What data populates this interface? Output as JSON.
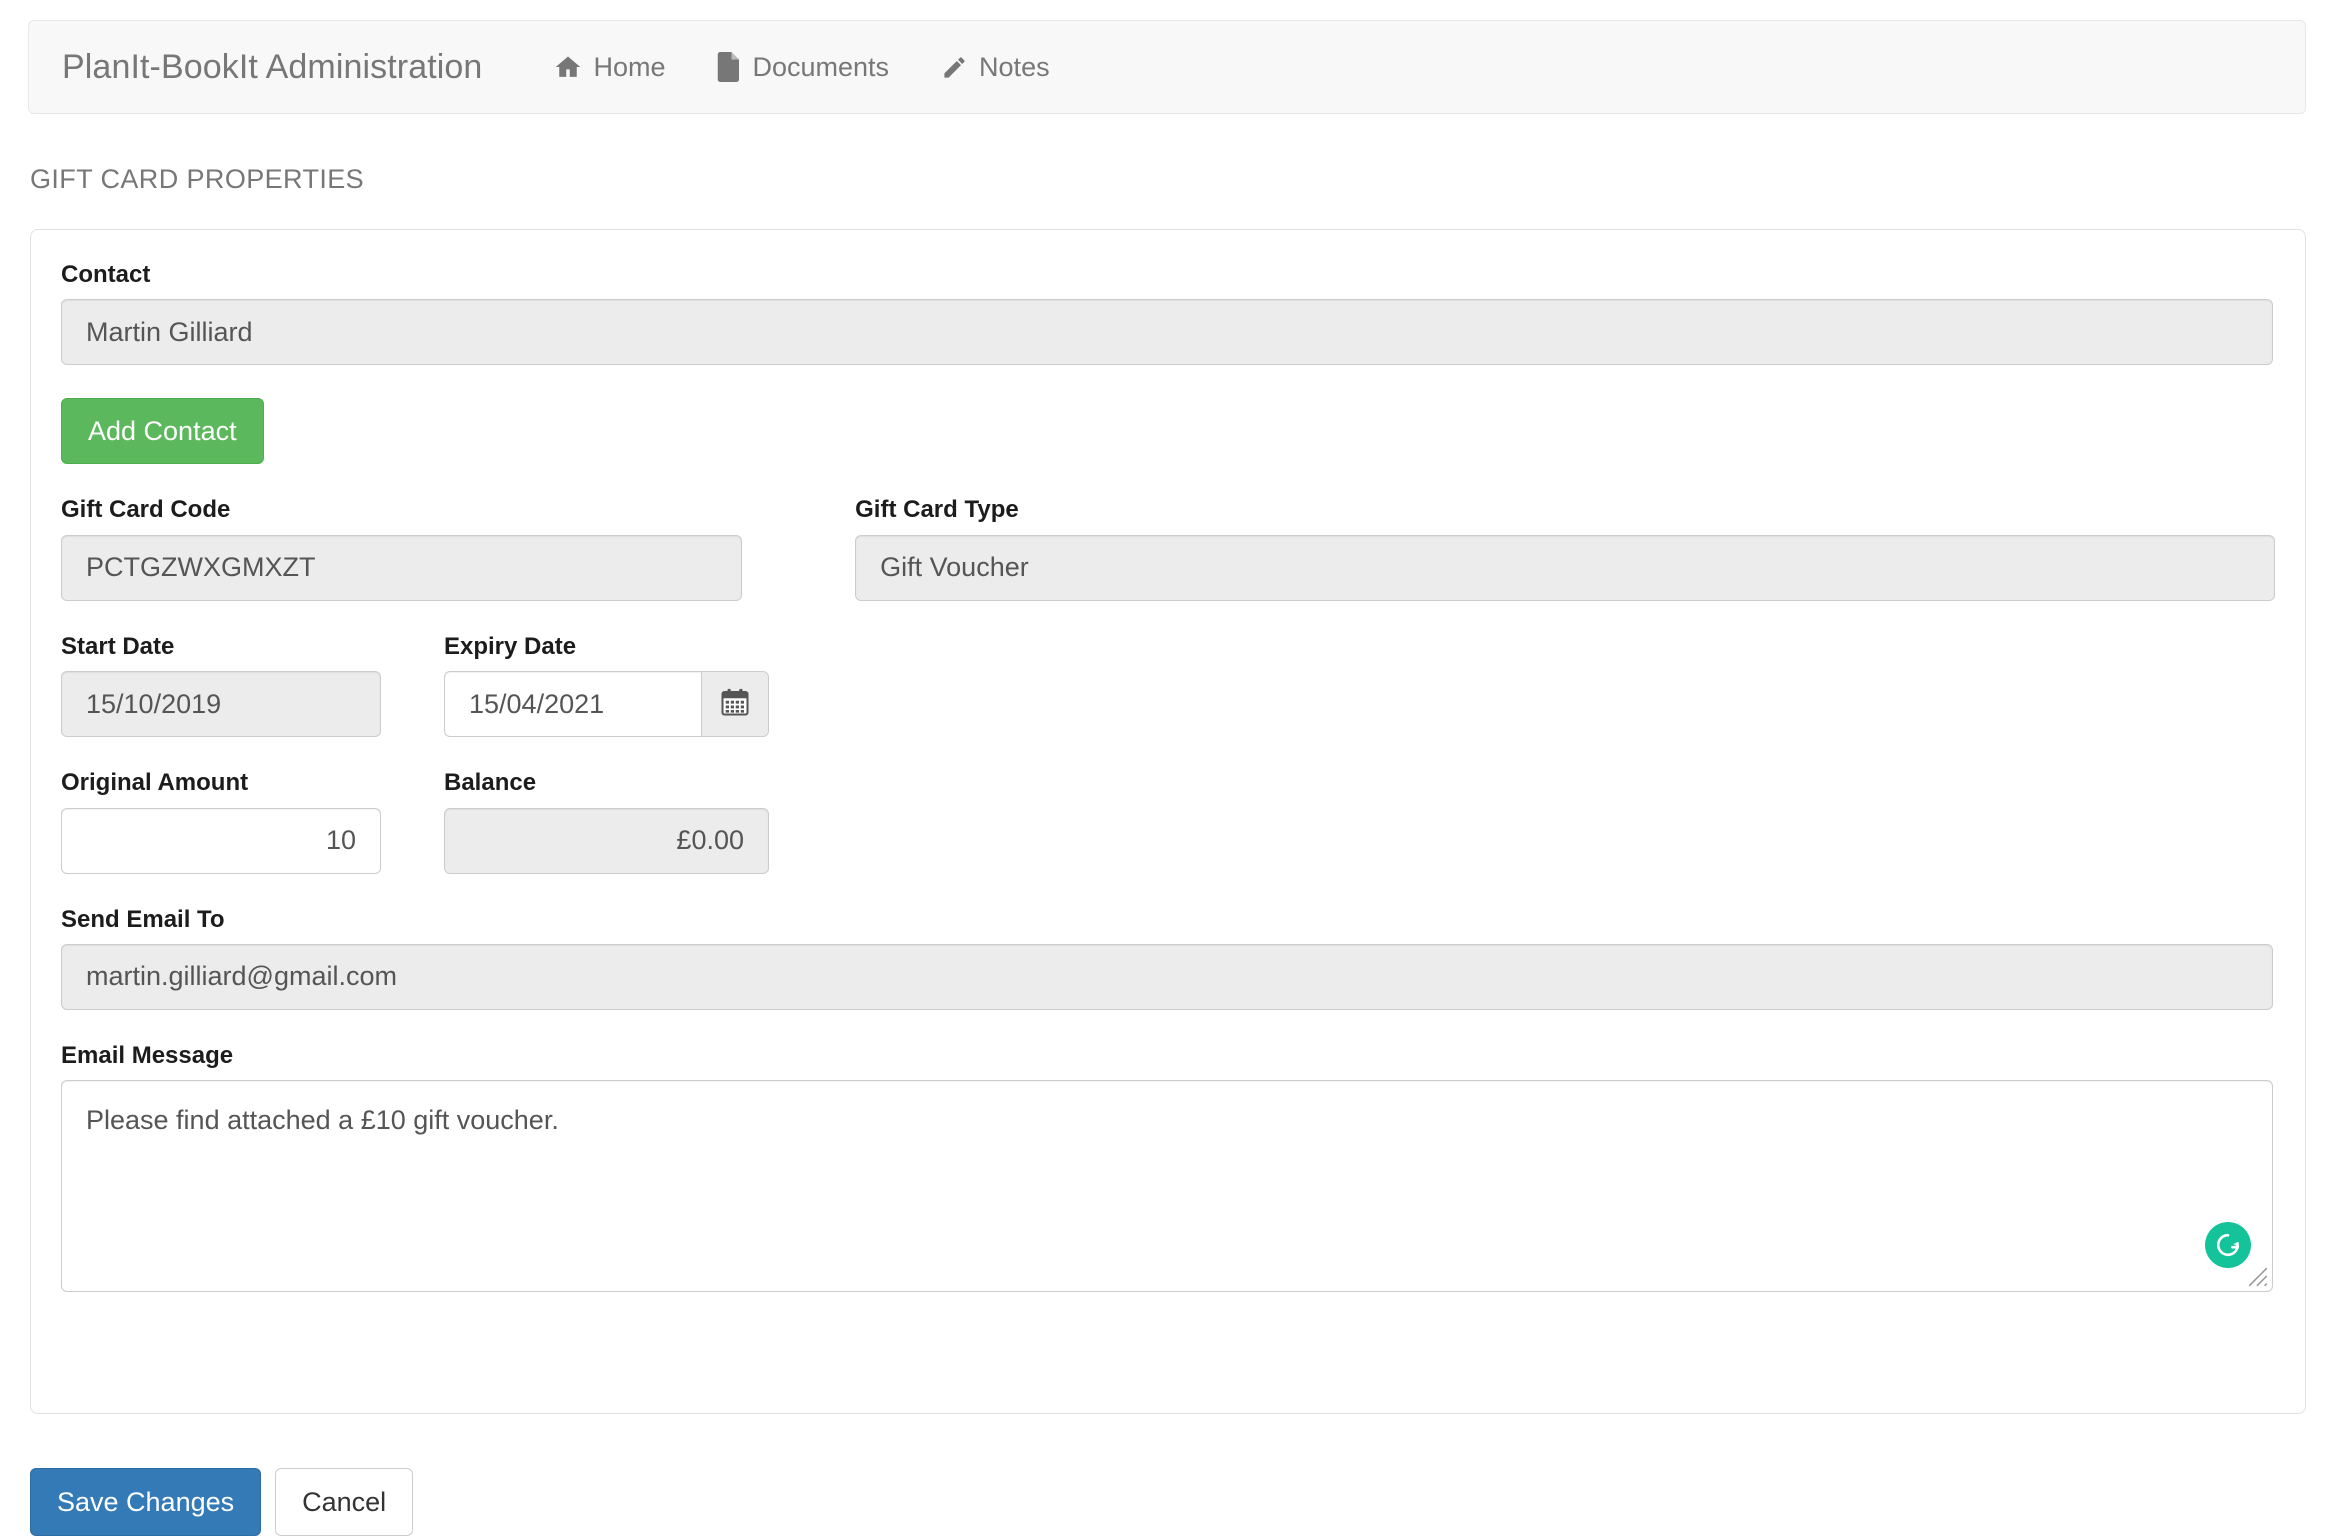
{
  "navbar": {
    "brand": "PlanIt-BookIt Administration",
    "links": [
      {
        "label": "Home",
        "icon": "home-icon"
      },
      {
        "label": "Documents",
        "icon": "document-icon"
      },
      {
        "label": "Notes",
        "icon": "pencil-icon"
      }
    ]
  },
  "page": {
    "title": "GIFT CARD PROPERTIES"
  },
  "form": {
    "contact": {
      "label": "Contact",
      "value": "Martin Gilliard",
      "disabled": true
    },
    "add_contact_button": "Add Contact",
    "gift_card_code": {
      "label": "Gift Card Code",
      "value": "PCTGZWXGMXZT",
      "disabled": true
    },
    "gift_card_type": {
      "label": "Gift Card Type",
      "value": "Gift Voucher",
      "disabled": true
    },
    "start_date": {
      "label": "Start Date",
      "value": "15/10/2019",
      "disabled": true
    },
    "expiry_date": {
      "label": "Expiry Date",
      "value": "15/04/2021",
      "disabled": false,
      "calendar_icon": "calendar-icon"
    },
    "original_amount": {
      "label": "Original Amount",
      "value": "10",
      "disabled": false
    },
    "balance": {
      "label": "Balance",
      "value": "£0.00",
      "disabled": true
    },
    "send_email_to": {
      "label": "Send Email To",
      "value": "martin.gilliard@gmail.com",
      "disabled": true
    },
    "email_message": {
      "label": "Email Message",
      "value": "Please find attached a £10 gift voucher.",
      "disabled": false
    }
  },
  "actions": {
    "save": "Save Changes",
    "cancel": "Cancel"
  },
  "overlays": {
    "grammarly_badge": "G"
  },
  "colors": {
    "navbar_bg": "#f8f8f8",
    "brand_text": "#777777",
    "success_green": "#5cb85c",
    "primary_blue": "#337ab7",
    "disabled_field_bg": "#ececec",
    "field_border": "#cccccc",
    "grammarly_green": "#15c39a"
  }
}
